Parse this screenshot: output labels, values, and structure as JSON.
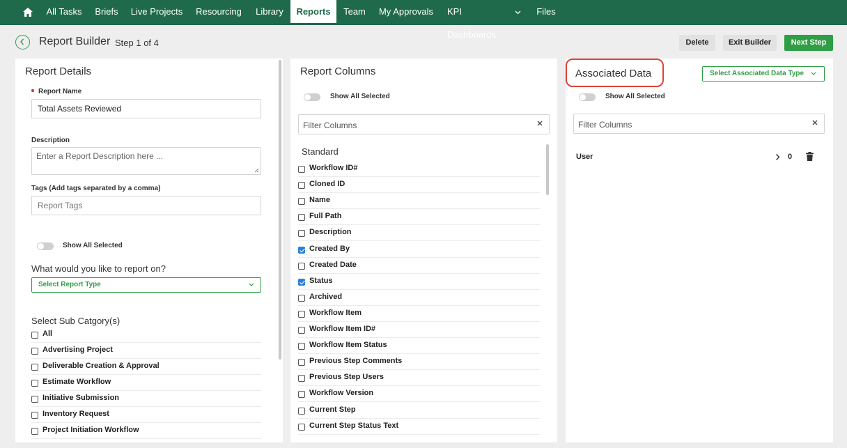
{
  "nav": {
    "items": [
      {
        "label": "All Tasks"
      },
      {
        "label": "Briefs"
      },
      {
        "label": "Live Projects"
      },
      {
        "label": "Resourcing"
      },
      {
        "label": "Library"
      },
      {
        "label": "Reports"
      },
      {
        "label": "Team"
      },
      {
        "label": "My Approvals"
      },
      {
        "label": "KPI Dashboards"
      },
      {
        "label": "Files"
      }
    ],
    "active": "Reports"
  },
  "header": {
    "title": "Report Builder",
    "step": "Step 1 of 4",
    "delete_label": "Delete",
    "exit_label": "Exit Builder",
    "next_label": "Next Step"
  },
  "details": {
    "title": "Report Details",
    "name_label": "Report Name",
    "name_value": "Total Assets Reviewed",
    "description_label": "Description",
    "description_placeholder": "Enter a Report Description here ...",
    "tags_label": "Tags (Add tags separated by a comma)",
    "tags_placeholder": "Report Tags",
    "show_all_label": "Show All Selected",
    "report_on_question": "What would you like to report on?",
    "report_type_placeholder": "Select Report Type",
    "subcat_heading": "Select Sub Catgory(s)",
    "subcategories": [
      {
        "label": "All",
        "checked": false
      },
      {
        "label": "Advertising Project",
        "checked": false
      },
      {
        "label": "Deliverable Creation & Approval",
        "checked": false
      },
      {
        "label": "Estimate Workflow",
        "checked": false
      },
      {
        "label": "Initiative Submission",
        "checked": false
      },
      {
        "label": "Inventory Request",
        "checked": false
      },
      {
        "label": "Project Initiation Workflow",
        "checked": false
      }
    ]
  },
  "columns": {
    "title": "Report Columns",
    "show_all_label": "Show All Selected",
    "filter_placeholder": "Filter Columns",
    "section": "Standard",
    "items": [
      {
        "label": "Workflow ID#",
        "checked": false
      },
      {
        "label": "Cloned ID",
        "checked": false
      },
      {
        "label": "Name",
        "checked": false
      },
      {
        "label": "Full Path",
        "checked": false
      },
      {
        "label": "Description",
        "checked": false
      },
      {
        "label": "Created By",
        "checked": true
      },
      {
        "label": "Created Date",
        "checked": false
      },
      {
        "label": "Status",
        "checked": true
      },
      {
        "label": "Archived",
        "checked": false
      },
      {
        "label": "Workflow Item",
        "checked": false
      },
      {
        "label": "Workflow Item ID#",
        "checked": false
      },
      {
        "label": "Workflow Item Status",
        "checked": false
      },
      {
        "label": "Previous Step Comments",
        "checked": false
      },
      {
        "label": "Previous Step Users",
        "checked": false
      },
      {
        "label": "Workflow Version",
        "checked": false
      },
      {
        "label": "Current Step",
        "checked": false
      },
      {
        "label": "Current Step Status Text",
        "checked": false
      }
    ]
  },
  "associated": {
    "title": "Associated Data",
    "select_label": "Select Associated Data Type",
    "show_all_label": "Show All Selected",
    "filter_placeholder": "Filter Columns",
    "rows": [
      {
        "label": "User",
        "count": "0"
      }
    ]
  },
  "colors": {
    "nav_bg": "#1e6a4a",
    "accent_green": "#2f9e44",
    "highlight_red": "#d9443a",
    "checkbox_blue": "#2a82d6"
  }
}
